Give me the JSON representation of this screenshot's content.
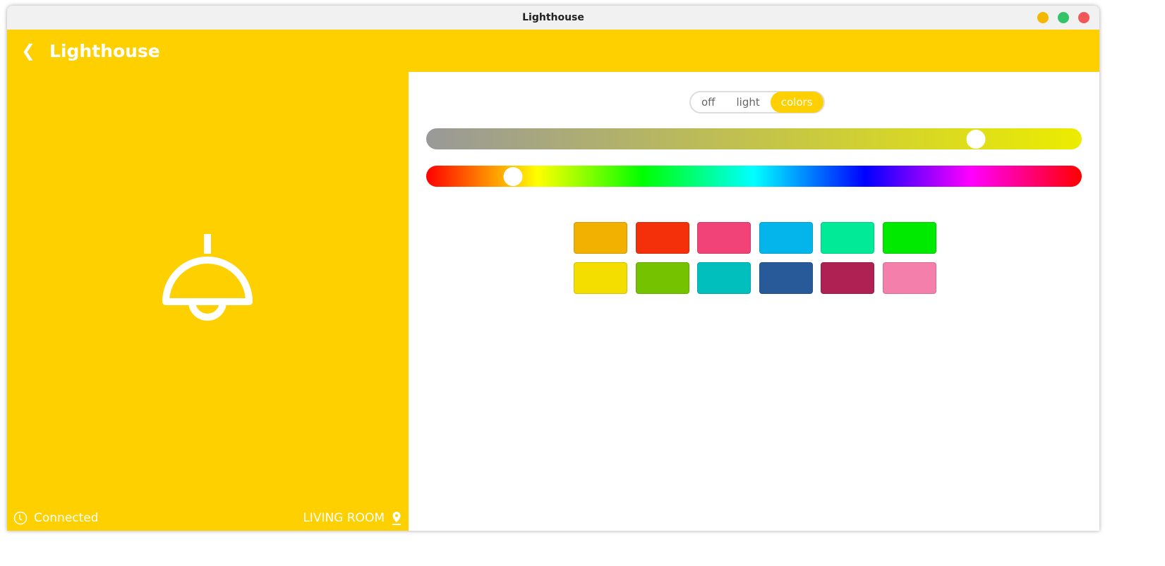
{
  "window": {
    "title": "Lighthouse",
    "controls": [
      {
        "name": "minimize",
        "color": "#f5b800"
      },
      {
        "name": "maximize",
        "color": "#33c46a"
      },
      {
        "name": "close",
        "color": "#f25757"
      }
    ]
  },
  "header": {
    "title": "Lighthouse"
  },
  "status": {
    "connection": "Connected",
    "room": "LIVING ROOM"
  },
  "modes": {
    "options": [
      "off",
      "light",
      "colors"
    ],
    "selected": "colors"
  },
  "sliders": {
    "saturation": 0.85,
    "hue": 0.12
  },
  "swatches": [
    "#F2B000",
    "#F4300A",
    "#F24378",
    "#03B5EA",
    "#00EA98",
    "#00EA00",
    "#F4DE00",
    "#75C200",
    "#00BFBD",
    "#285A9A",
    "#AF2053",
    "#F47FAA"
  ],
  "accent": "#FFD000"
}
